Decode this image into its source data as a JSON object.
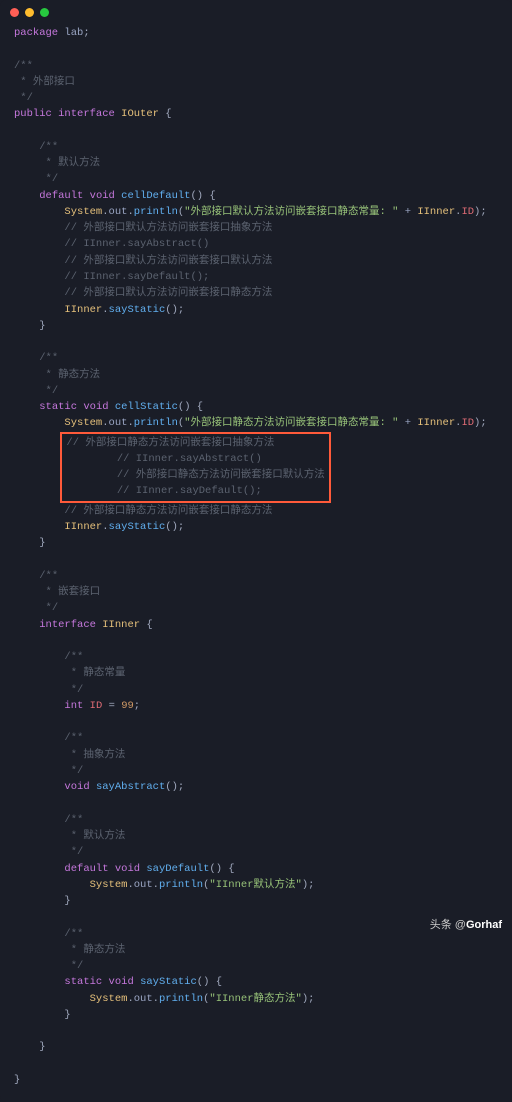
{
  "package_kw": "package",
  "package_name": "lab",
  "c1a": "/**",
  "c1b": " * 外部接口",
  "c1c": " */",
  "public_kw": "public",
  "interface_kw": "interface",
  "outer_name": "IOuter",
  "c2a": "/**",
  "c2b": " * 默认方法",
  "c2c": " */",
  "default_kw": "default",
  "void_kw": "void",
  "cellDefault": "cellDefault",
  "sys": "System",
  "out": "out",
  "println": "println",
  "str1": "\"外部接口默认方法访问嵌套接口静态常量: \"",
  "plus": " + ",
  "iinner": "IInner",
  "id": "ID",
  "cm1": "// 外部接口默认方法访问嵌套接口抽象方法",
  "cm2": "// IInner.sayAbstract()",
  "cm3": "// 外部接口默认方法访问嵌套接口默认方法",
  "cm4": "// IInner.sayDefault();",
  "cm5": "// 外部接口默认方法访问嵌套接口静态方法",
  "sayStatic": "sayStatic",
  "c3a": "/**",
  "c3b": " * 静态方法",
  "c3c": " */",
  "static_kw": "static",
  "cellStatic": "cellStatic",
  "str2": "\"外部接口静态方法访问嵌套接口静态常量: \"",
  "bx1": "// 外部接口静态方法访问嵌套接口抽象方法",
  "bx2": "// IInner.sayAbstract()",
  "bx3": "// 外部接口静态方法访问嵌套接口默认方法",
  "bx4": "// IInner.sayDefault();",
  "cm6": "// 外部接口静态方法访问嵌套接口静态方法",
  "c4a": "/**",
  "c4b": " * 嵌套接口",
  "c4c": " */",
  "inner_name": "IInner",
  "c5a": "/**",
  "c5b": " * 静态常量",
  "c5c": " */",
  "int_kw": "int",
  "id_field": "ID",
  "num": "99",
  "c6a": "/**",
  "c6b": " * 抽象方法",
  "c6c": " */",
  "sayAbstract": "sayAbstract",
  "c7a": "/**",
  "c7b": " * 默认方法",
  "c7c": " */",
  "sayDefault": "sayDefault",
  "str3": "\"IInner默认方法\"",
  "c8a": "/**",
  "c8b": " * 静态方法",
  "c8c": " */",
  "str4": "\"IInner静态方法\"",
  "attrib_pre": "头条 @",
  "attrib_name": "Gorhaf"
}
